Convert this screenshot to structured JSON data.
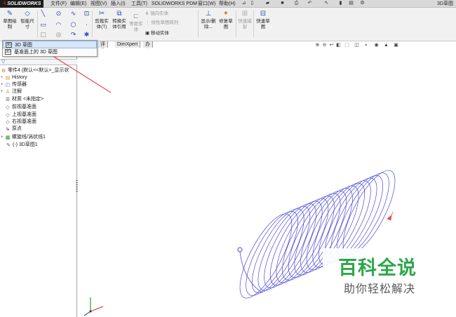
{
  "titlebar": {
    "brand": "SOLIDWORKS",
    "menus": [
      "文件(F)",
      "编辑(E)",
      "视图(V)",
      "插入(I)",
      "工具(T)",
      "SOLIDWORKS PDM",
      "窗口(W)",
      "帮助(H)"
    ],
    "app_title": "3D草图"
  },
  "ribbon": {
    "sketch": "草图绘制",
    "smart_dim": "智能尺寸",
    "trim": "剪裁实体(T)",
    "convert": "转换实体引用",
    "offset": "等距实体",
    "mirror": "镜向实体",
    "linear_pattern": "线性草图阵列",
    "move": "移动实体",
    "display_delete": "显示/删除...",
    "repair": "修复草图",
    "rapid": "快速捕捉",
    "quick_sketch": "快速草图"
  },
  "dropdown": {
    "items": [
      {
        "label": "3D 草图"
      },
      {
        "label": "基准面上的 3D 草图"
      }
    ]
  },
  "tabs": [
    "评估",
    "DimXpert",
    "办公室产品"
  ],
  "tree": {
    "root": "零件4 (默认<<默认>_显示状",
    "items": [
      "History",
      "传感器",
      "注解",
      "材质 <未指定>",
      "前视基准面",
      "上视基准面",
      "右视基准面",
      "原点",
      "螺旋线/涡状线1",
      "(-) 3D草图1"
    ]
  },
  "watermark": {
    "title": "百科全说",
    "subtitle": "助你轻松解决"
  },
  "colors": {
    "helix": "#4a4ad8",
    "arrow": "#e05050",
    "watermark_green": "#2da74a"
  }
}
